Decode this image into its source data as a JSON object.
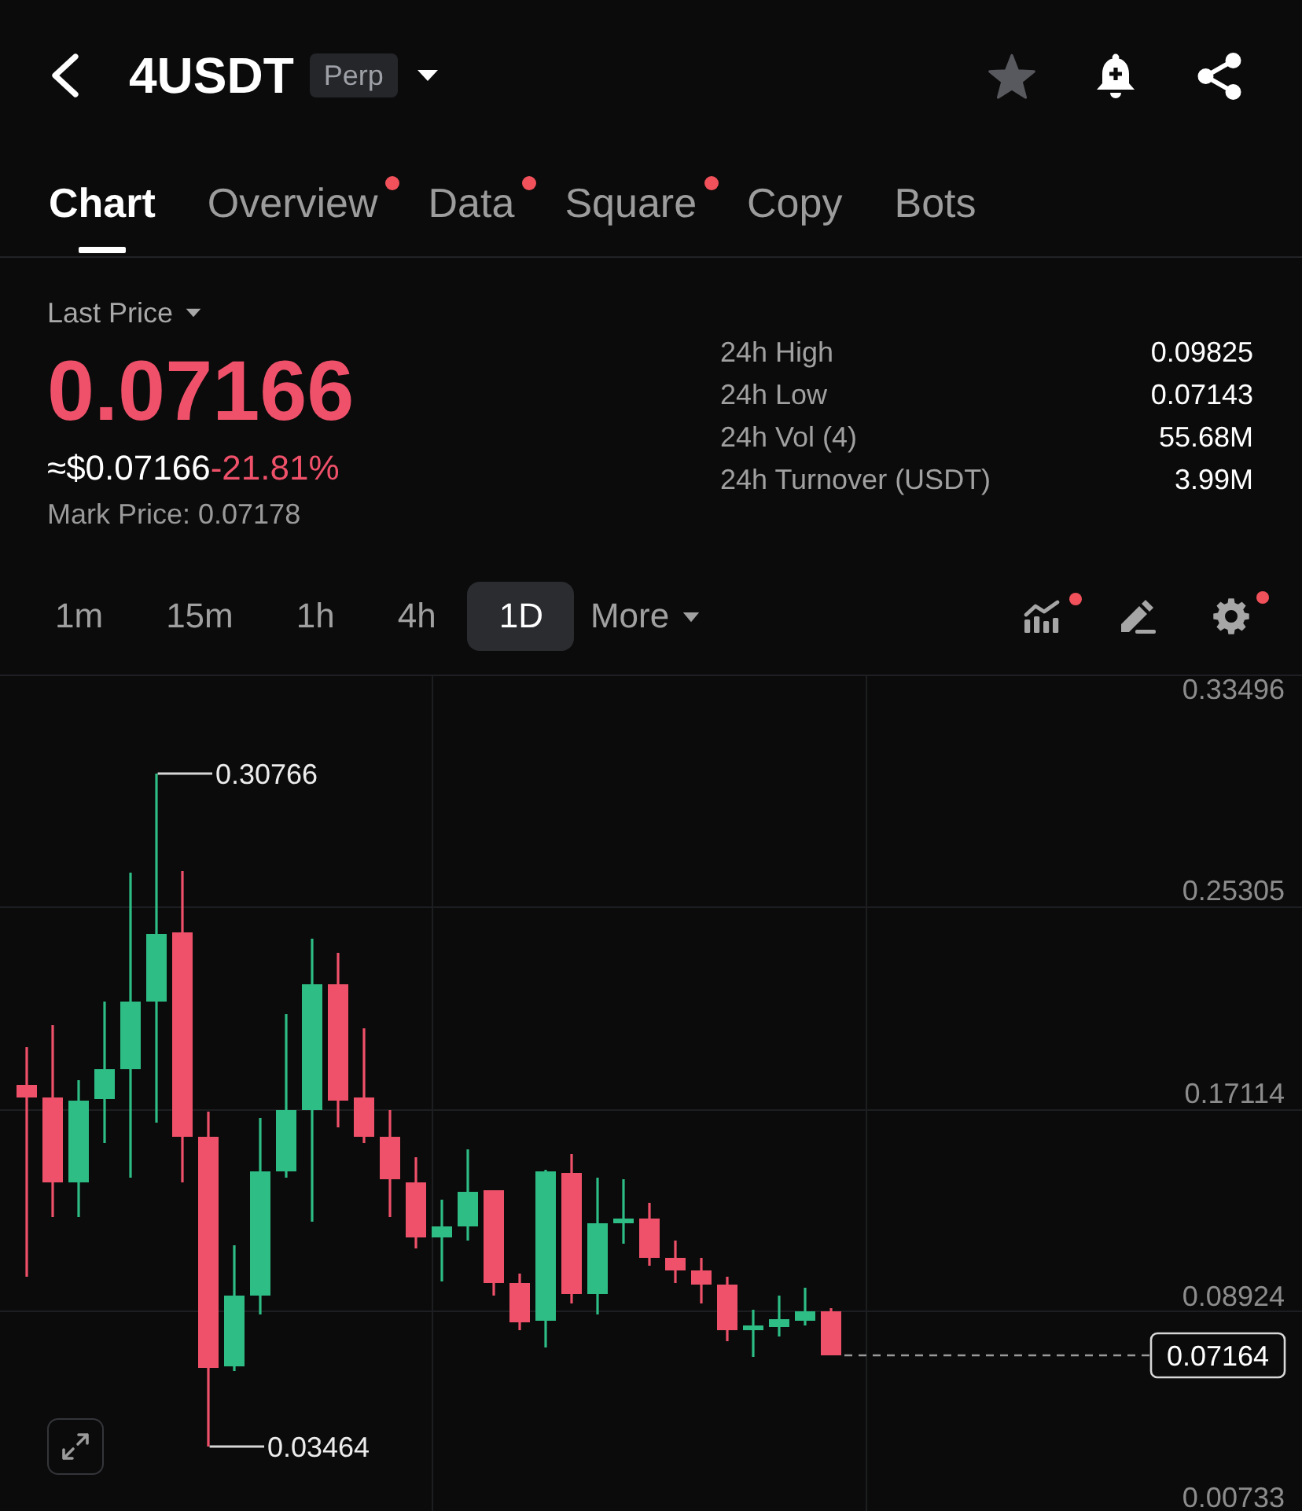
{
  "header": {
    "symbol": "4USDT",
    "badge": "Perp",
    "favorite": false
  },
  "tabs": [
    {
      "label": "Chart",
      "selected": true,
      "dot": false
    },
    {
      "label": "Overview",
      "selected": false,
      "dot": true
    },
    {
      "label": "Data",
      "selected": false,
      "dot": true
    },
    {
      "label": "Square",
      "selected": false,
      "dot": true
    },
    {
      "label": "Copy",
      "selected": false,
      "dot": false
    },
    {
      "label": "Bots",
      "selected": false,
      "dot": false
    }
  ],
  "price": {
    "label": "Last Price",
    "last": "0.07166",
    "approx": "≈$0.07166",
    "change": "-21.81%",
    "falling": true,
    "mark_price": "Mark Price: 0.07178"
  },
  "stats": [
    {
      "label": "24h High",
      "value": "0.09825"
    },
    {
      "label": "24h Low",
      "value": "0.07143"
    },
    {
      "label": "24h Vol (4)",
      "value": "55.68M"
    },
    {
      "label": "24h Turnover (USDT)",
      "value": "3.99M"
    }
  ],
  "intervals": [
    {
      "label": "1m",
      "selected": false
    },
    {
      "label": "15m",
      "selected": false
    },
    {
      "label": "1h",
      "selected": false
    },
    {
      "label": "4h",
      "selected": false
    },
    {
      "label": "1D",
      "selected": true
    }
  ],
  "more": "More",
  "tools": [
    {
      "kind": "indicators",
      "dot": true
    },
    {
      "kind": "drawing",
      "dot": false
    },
    {
      "kind": "settings",
      "dot": true
    }
  ],
  "chart": {
    "price_axis": [
      "0.33496",
      "0.25305",
      "0.17114",
      "0.08924",
      "0.00733"
    ],
    "high_label": "0.30766",
    "low_label": "0.03464",
    "last_price_tag": "0.07164"
  }
}
